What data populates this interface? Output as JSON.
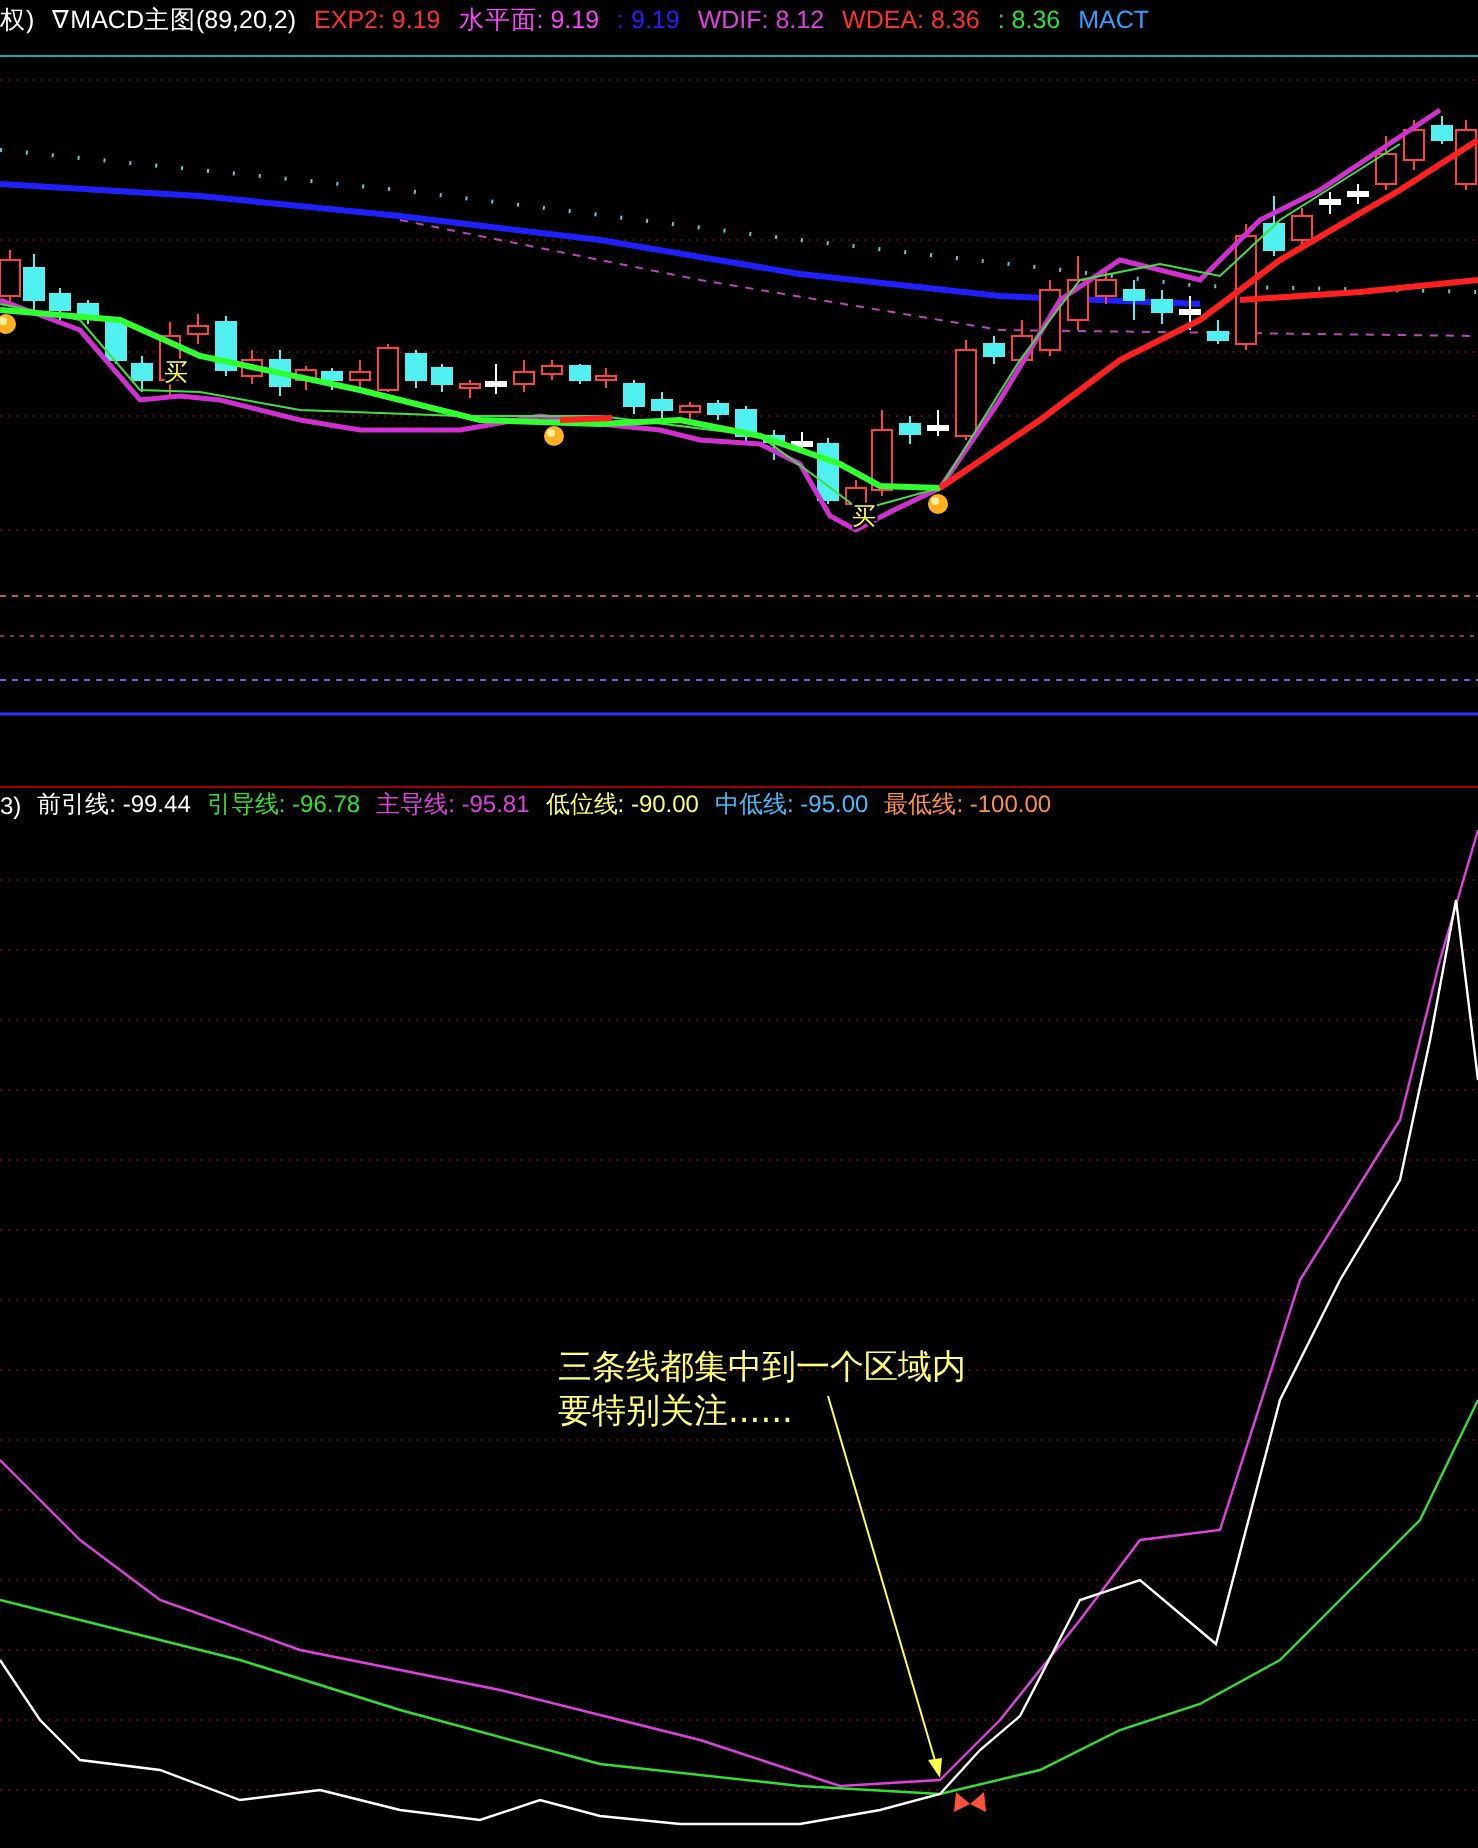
{
  "main_header": {
    "title_prefix": "权)",
    "title": "∇MACD主图(89,20,2)",
    "indicators": [
      {
        "label": "EXP2: 9.19",
        "color": "#ff3030"
      },
      {
        "label": "水平面: 9.19",
        "color": "#ff40ff"
      },
      {
        "label": ": 9.19",
        "color": "#2020ff"
      },
      {
        "label": "WDIF: 8.12",
        "color": "#e040e0"
      },
      {
        "label": "WDEA: 8.36",
        "color": "#ff3030"
      },
      {
        "label": ": 8.36",
        "color": "#30e030"
      },
      {
        "label": "MACT",
        "color": "#30a0ff"
      }
    ]
  },
  "main_chart": {
    "buy_marks": [
      "买",
      "买"
    ]
  },
  "sub_header": {
    "prefix": "3)",
    "indicators": [
      {
        "label": "前引线: -99.44",
        "color": "#ffffff"
      },
      {
        "label": "引导线: -96.78",
        "color": "#30e030"
      },
      {
        "label": "主导线: -95.81",
        "color": "#e040e0"
      },
      {
        "label": "低位线: -90.00",
        "color": "#ffff60"
      },
      {
        "label": "中低线: -95.00",
        "color": "#40c0ff"
      },
      {
        "label": "最低线: -100.00",
        "color": "#ff9040"
      }
    ]
  },
  "sub_chart": {
    "annotation": [
      "三条线都集中到一个区域内",
      "要特别关注......"
    ]
  }
}
